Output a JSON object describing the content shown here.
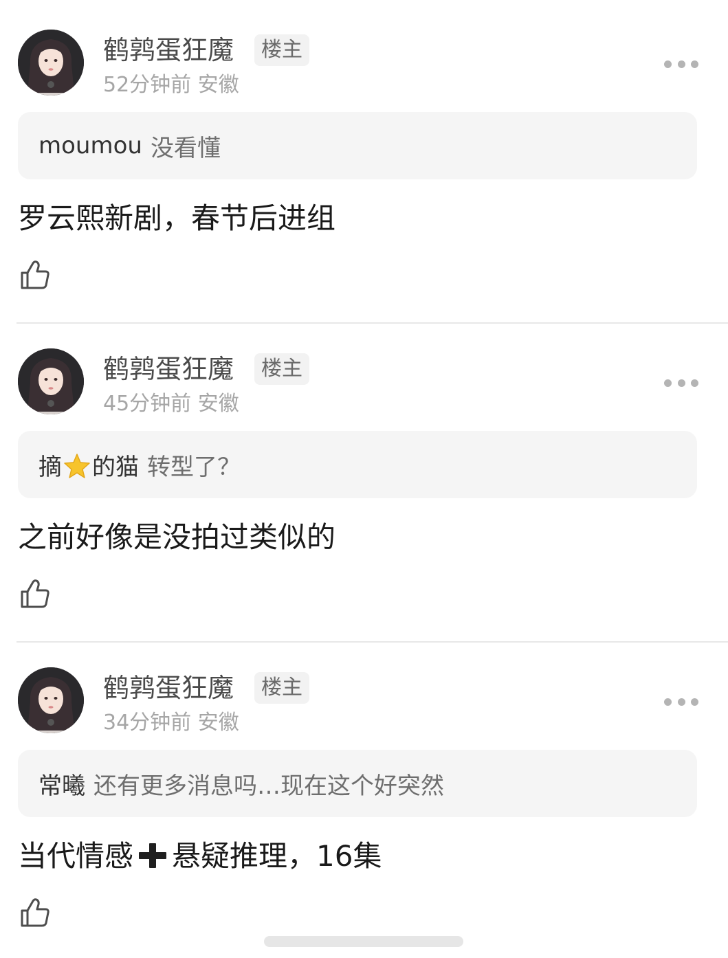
{
  "posts": [
    {
      "username": "鹤鹑蛋狂魔",
      "badge": "楼主",
      "time": "52分钟前",
      "location": "安徽",
      "quote_user": "moumou",
      "quote_text": "没看懂",
      "content": "罗云熙新剧，春节后进组"
    },
    {
      "username": "鹤鹑蛋狂魔",
      "badge": "楼主",
      "time": "45分钟前",
      "location": "安徽",
      "quote_user_pre": "摘",
      "quote_user_icon": "star-emoji",
      "quote_user_post": "的猫",
      "quote_text": "转型了？",
      "content": "之前好像是没拍过类似的"
    },
    {
      "username": "鹤鹑蛋狂魔",
      "badge": "楼主",
      "time": "34分钟前",
      "location": "安徽",
      "quote_user": "常曦",
      "quote_text": "还有更多消息吗…现在这个好突然",
      "content_pre": "当代情感",
      "content_icon": "plus-emoji",
      "content_post": "悬疑推理，16集"
    }
  ],
  "icons": {
    "more": "more-dots-icon",
    "like": "thumbs-up-icon"
  },
  "colors": {
    "username": "#4a4a4a",
    "meta": "#a6a6a6",
    "quote_bg": "#f5f5f5",
    "divider": "#e8e8e8",
    "star": "#f7c42c"
  }
}
